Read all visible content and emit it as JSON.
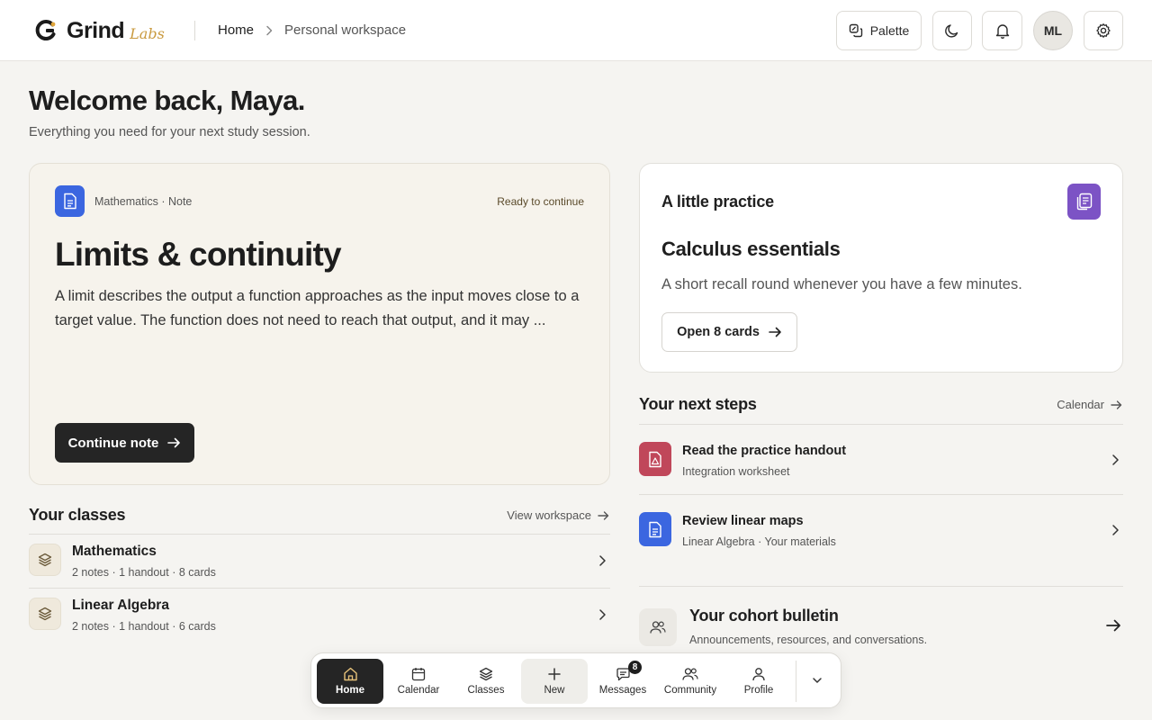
{
  "header": {
    "logo_word": "Grind",
    "logo_sub": "Labs",
    "breadcrumb": [
      "Home",
      "Personal workspace"
    ],
    "palette_label": "Palette",
    "avatar_initials": "ML"
  },
  "welcome": {
    "title": "Welcome back, Maya.",
    "subtitle": "Everything you need for your next study session."
  },
  "hero": {
    "meta": "Mathematics · Note",
    "status": "Ready to continue",
    "title": "Limits & continuity",
    "body": "A limit describes the output a function approaches as the input moves close to a target value. The function does not need to reach that output, and it may ...",
    "button": "Continue note",
    "accent": "#3b66e0"
  },
  "practice": {
    "label": "A little practice",
    "title": "Calculus essentials",
    "description": "A short recall round whenever you have a few minutes.",
    "button": "Open 8 cards",
    "accent": "#7c53c5"
  },
  "classes": {
    "title": "Your classes",
    "link": "View workspace",
    "items": [
      {
        "name": "Mathematics",
        "meta": "2 notes · 1 handout · 8 cards"
      },
      {
        "name": "Linear Algebra",
        "meta": "2 notes · 1 handout · 6 cards"
      }
    ]
  },
  "next_steps": {
    "title": "Your next steps",
    "link": "Calendar",
    "items": [
      {
        "title": "Read the practice handout",
        "sub": "Integration worksheet",
        "icon": "pdf-file-icon",
        "color": "#c0475a"
      },
      {
        "title": "Review linear maps",
        "sub": "Linear Algebra · Your materials",
        "icon": "document-icon",
        "color": "#3b66e0"
      }
    ]
  },
  "bulletin": {
    "title": "Your cohort bulletin",
    "sub": "Announcements, resources, and conversations."
  },
  "dock": {
    "items": [
      {
        "label": "Home",
        "icon": "home-icon"
      },
      {
        "label": "Calendar",
        "icon": "calendar-icon"
      },
      {
        "label": "Classes",
        "icon": "layers-icon"
      },
      {
        "label": "New",
        "icon": "plus-icon"
      },
      {
        "label": "Messages",
        "icon": "chat-icon",
        "badge": "8"
      },
      {
        "label": "Community",
        "icon": "users-icon"
      },
      {
        "label": "Profile",
        "icon": "user-icon"
      }
    ]
  }
}
